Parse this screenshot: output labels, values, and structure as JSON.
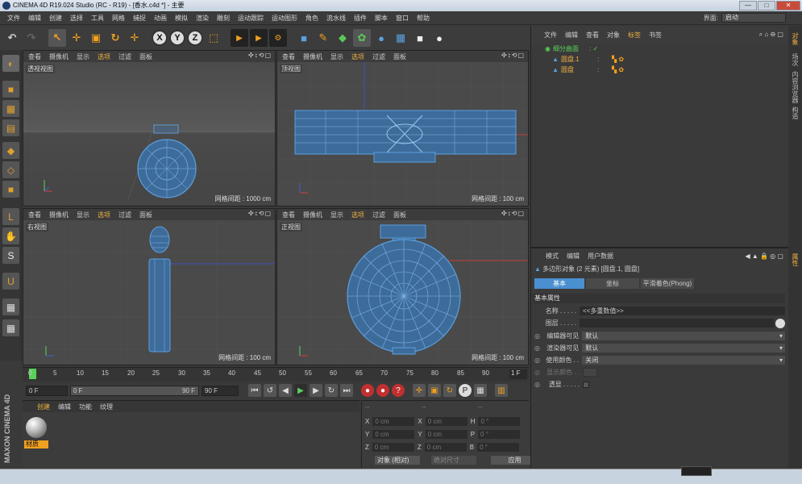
{
  "window": {
    "title": "CINEMA 4D R19.024 Studio (RC - R19) - [香水.c4d *] - 主要",
    "buttons": [
      "—",
      "□",
      "✕"
    ]
  },
  "menu": [
    "文件",
    "编辑",
    "创建",
    "选择",
    "工具",
    "网格",
    "捕捉",
    "动画",
    "模拟",
    "渲染",
    "雕刻",
    "运动跟踪",
    "运动图形",
    "角色",
    "流水线",
    "插件",
    "脚本",
    "窗口",
    "帮助"
  ],
  "layout": {
    "label": "界面:",
    "value": "启动"
  },
  "toolbar": {
    "undo": "↶",
    "redo": "↷",
    "live": "↖",
    "move": "✛",
    "scale": "▣",
    "rotate": "↻",
    "add": "✛",
    "x": "X",
    "y": "Y",
    "z": "Z",
    "coord": "⬚",
    "render1": "▶",
    "render2": "▶",
    "render3": "⚙",
    "cube": "■",
    "pen": "✎",
    "gen": "◆",
    "deform": "✿",
    "env": "●",
    "floor": "▦",
    "cam": "■",
    "light": "●"
  },
  "viewports": [
    {
      "menus": [
        "查看",
        "摄像机",
        "显示",
        "选项",
        "过滤",
        "面板"
      ],
      "active": "选项",
      "name": "透视视图",
      "grid": "网格间距 : 1000 cm"
    },
    {
      "menus": [
        "查看",
        "摄像机",
        "显示",
        "选项",
        "过滤",
        "面板"
      ],
      "active": "选项",
      "name": "顶视图",
      "grid": "网格间距 : 100 cm"
    },
    {
      "menus": [
        "查看",
        "摄像机",
        "显示",
        "选项",
        "过滤",
        "面板"
      ],
      "active": "选项",
      "name": "右视图",
      "grid": "网格间距 : 100 cm"
    },
    {
      "menus": [
        "查看",
        "摄像机",
        "显示",
        "选项",
        "过滤",
        "面板"
      ],
      "active": "选项",
      "name": "正视图",
      "grid": "网格间距 : 100 cm"
    }
  ],
  "viewport_navi": "✣↕⟲▢",
  "timeline": {
    "ticks": [
      "0",
      "5",
      "10",
      "15",
      "20",
      "25",
      "30",
      "35",
      "40",
      "45",
      "50",
      "55",
      "60",
      "65",
      "70",
      "75",
      "80",
      "85",
      "90"
    ],
    "frame": "1 F"
  },
  "transport": {
    "start": "0 F",
    "current": "0 F",
    "end_slider": "90 F",
    "end": "90 F"
  },
  "materials": {
    "tabs": [
      "创建",
      "编辑",
      "功能",
      "纹理"
    ],
    "active": "创建",
    "item": "材质",
    "brand": "MAXON CINEMA 4D"
  },
  "coords": {
    "rows": [
      {
        "a": "X",
        "av": "0 cm",
        "b": "X",
        "bv": "0 cm",
        "c": "H",
        "cv": "0 °"
      },
      {
        "a": "Y",
        "av": "0 cm",
        "b": "Y",
        "bv": "0 cm",
        "c": "P",
        "cv": "0 °"
      },
      {
        "a": "Z",
        "av": "0 cm",
        "b": "Z",
        "bv": "0 cm",
        "c": "B",
        "cv": "0 °"
      }
    ],
    "header": [
      "--",
      "--",
      "--"
    ],
    "mode": "对象 (相对)",
    "size": "绝对尺寸",
    "apply": "应用"
  },
  "objects": {
    "tabs": [
      "文件",
      "编辑",
      "查看",
      "对象",
      "标签",
      "书签"
    ],
    "active": "标签",
    "items": [
      {
        "name": "细分曲面"
      },
      {
        "name": "圆盘.1"
      },
      {
        "name": "圆盘"
      }
    ]
  },
  "attributes": {
    "tabs": [
      "模式",
      "编辑",
      "用户数据"
    ],
    "title": "多边形对象 (2 元素) [圆盘.1, 圆盘]",
    "subtabs": [
      "基本",
      "坐标",
      "平滑着色(Phong)"
    ],
    "active": "基本",
    "section": "基本属性",
    "name_label": "名称 . . . . .",
    "name_value": "<<多重数值>>",
    "layer_label": "图层 . . . . .",
    "editor_vis_label": "编辑器可见",
    "editor_vis": "默认",
    "render_vis_label": "渲染器可见",
    "render_vis": "默认",
    "use_color_label": "使用颜色 . .",
    "use_color": "关闭",
    "display_color_label": "显示颜色 . .",
    "xray_label": "透显 . . . . ."
  },
  "right_tabs": [
    "对象",
    "场次",
    "内容浏览器",
    "构造"
  ],
  "right_tab_attr": "属性",
  "wire_color": "#5a9fe0",
  "accent": "#f0a020"
}
